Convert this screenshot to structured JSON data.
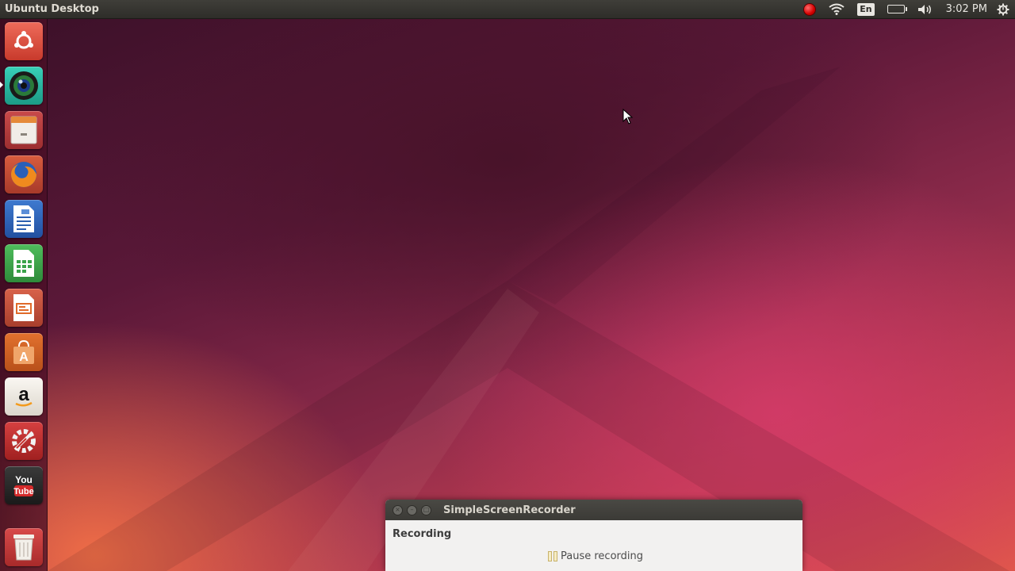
{
  "panel": {
    "title": "Ubuntu Desktop",
    "keyboard_layout": "En",
    "clock": "3:02 PM",
    "indicators": [
      "recording-indicator-icon",
      "wifi-icon",
      "keyboard-layout-indicator",
      "battery-icon",
      "volume-icon",
      "clock",
      "session-gear-icon"
    ],
    "recording_indicator_color": "#d40000"
  },
  "launcher": {
    "items": [
      {
        "name": "dash-home",
        "icon": "ubuntu-logo-icon",
        "color": "#e04a3a"
      },
      {
        "name": "simplescreenrecorder",
        "icon": "camera-lens-icon",
        "color": "#26b7a2",
        "running": true
      },
      {
        "name": "files",
        "icon": "file-cabinet-icon",
        "color": "#e9e3dc"
      },
      {
        "name": "firefox",
        "icon": "firefox-icon",
        "color": "#e8582b"
      },
      {
        "name": "libreoffice-writer",
        "icon": "writer-document-icon",
        "color": "#2b5fb0"
      },
      {
        "name": "libreoffice-calc",
        "icon": "calc-spreadsheet-icon",
        "color": "#3aa34a"
      },
      {
        "name": "libreoffice-impress",
        "icon": "impress-presentation-icon",
        "color": "#e06a2a"
      },
      {
        "name": "software-center",
        "icon": "shopping-bag-icon",
        "color": "#e2712e"
      },
      {
        "name": "amazon",
        "icon": "amazon-icon",
        "color": "#f3efe9",
        "glyph": "a"
      },
      {
        "name": "system-settings",
        "icon": "settings-tools-icon",
        "color": "#c9302c"
      },
      {
        "name": "youtube",
        "icon": "youtube-icon",
        "color": "#d42a2a",
        "glyph_top": "You",
        "glyph_bottom": "Tube"
      },
      {
        "name": "trash",
        "icon": "trash-icon",
        "color": "#e9e6e0"
      }
    ]
  },
  "recorder": {
    "title": "SimpleScreenRecorder",
    "section_label": "Recording",
    "pause_label": "Pause recording"
  }
}
